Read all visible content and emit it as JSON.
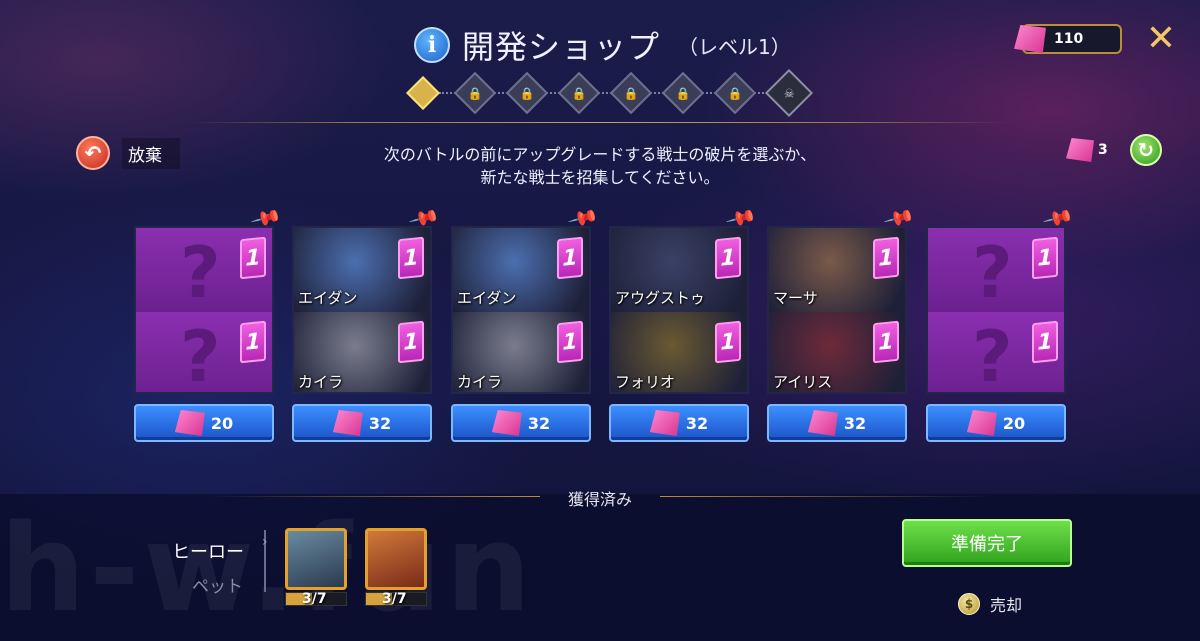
{
  "header": {
    "title": "開発ショップ",
    "level": "（レベル1）",
    "info_icon": "info-icon"
  },
  "progress_nodes": [
    "active",
    "locked",
    "locked",
    "locked",
    "locked",
    "locked",
    "locked",
    "boss"
  ],
  "currency": {
    "value": "110",
    "icon": "pink-gem-icon"
  },
  "give_up": {
    "label": "放棄"
  },
  "instructions": {
    "line1": "次のバトルの前にアップグレードする戦士の破片を選ぶか、",
    "line2": "新たな戦士を招集してください。"
  },
  "reroll": {
    "count": "3"
  },
  "cards": [
    {
      "top": {
        "name": "",
        "count": "1",
        "empty": true
      },
      "bottom": {
        "name": "",
        "count": "1",
        "empty": true
      },
      "price": "20"
    },
    {
      "top": {
        "name": "エイダン",
        "count": "1",
        "empty": false,
        "color": "#4c6fb0"
      },
      "bottom": {
        "name": "カイラ",
        "count": "1",
        "empty": false,
        "color": "#7b7d8e"
      },
      "price": "32"
    },
    {
      "top": {
        "name": "エイダン",
        "count": "1",
        "empty": false,
        "color": "#4c6fb0"
      },
      "bottom": {
        "name": "カイラ",
        "count": "1",
        "empty": false,
        "color": "#7b7d8e"
      },
      "price": "32"
    },
    {
      "top": {
        "name": "アウグストゥ",
        "count": "1",
        "empty": false,
        "color": "#3a4166"
      },
      "bottom": {
        "name": "フォリオ",
        "count": "1",
        "empty": false,
        "color": "#6a5a32"
      },
      "price": "32"
    },
    {
      "top": {
        "name": "マーサ",
        "count": "1",
        "empty": false,
        "color": "#7a5a4a"
      },
      "bottom": {
        "name": "アイリス",
        "count": "1",
        "empty": false,
        "color": "#6e2a3a"
      },
      "price": "32"
    },
    {
      "top": {
        "name": "",
        "count": "1",
        "empty": true
      },
      "bottom": {
        "name": "",
        "count": "1",
        "empty": true
      },
      "price": "20"
    }
  ],
  "acquired": {
    "title": "獲得済み",
    "tab_hero": "ヒーロー",
    "tab_pet": "ペット",
    "items": [
      {
        "count": "3/7",
        "progress": 0.43,
        "color": "#4a6a80"
      },
      {
        "count": "3/7",
        "progress": 0.43,
        "color": "#9a4a2a"
      }
    ]
  },
  "ready_button": "準備完了",
  "sell": {
    "label": "売却"
  },
  "watermark": "h-w.fun"
}
